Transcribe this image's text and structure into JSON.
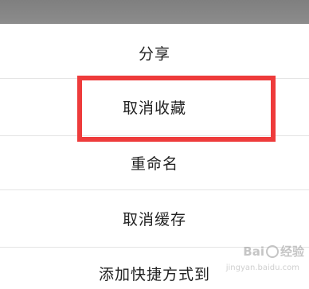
{
  "menu": {
    "items": [
      {
        "label": "分享"
      },
      {
        "label": "取消收藏"
      },
      {
        "label": "重命名"
      },
      {
        "label": "取消缓存"
      },
      {
        "label": "添加快捷方式到"
      }
    ]
  },
  "highlight": {
    "color": "#ee3b3b",
    "target": "取消收藏"
  },
  "watermark": {
    "brand_prefix": "Bai",
    "brand_suffix": "经验",
    "sub": "jingyan.baidu.com"
  }
}
